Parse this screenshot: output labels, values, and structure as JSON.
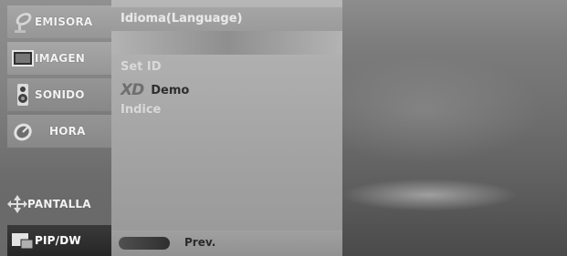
{
  "sidebar": {
    "items": [
      {
        "label": "EMISORA",
        "icon": "satellite-dish-icon"
      },
      {
        "label": "IMAGEN",
        "icon": "monitor-icon"
      },
      {
        "label": "SONIDO",
        "icon": "speaker-icon"
      },
      {
        "label": "HORA",
        "icon": "clock-icon"
      },
      {
        "label": "PANTALLA",
        "icon": "arrows-icon"
      },
      {
        "label": "PIP/DW",
        "icon": "pip-icon"
      }
    ]
  },
  "panel": {
    "title": "Idioma(Language)",
    "options": [
      {
        "label": "Set ID"
      },
      {
        "logo": "XD",
        "label": "Demo"
      },
      {
        "label": "Indice"
      }
    ],
    "footer": {
      "prev_label": "Prev."
    }
  }
}
